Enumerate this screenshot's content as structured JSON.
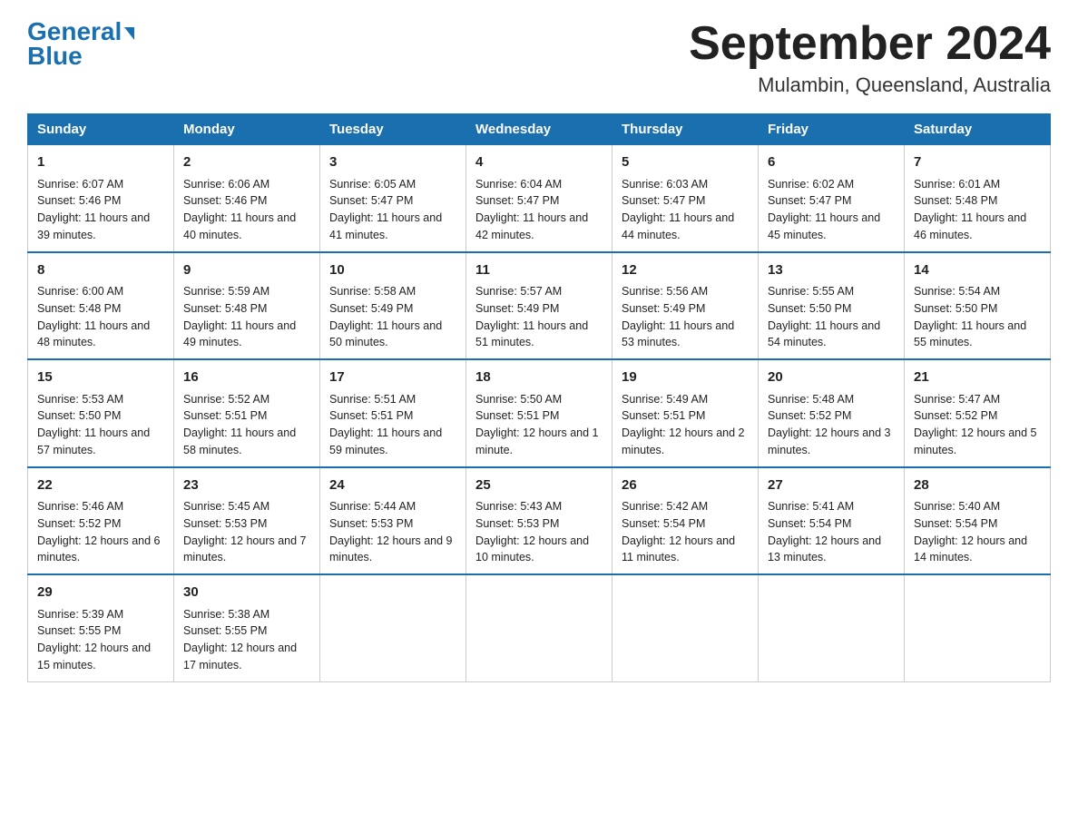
{
  "logo": {
    "general": "General",
    "blue": "Blue",
    "arrowColor": "#1a6fae"
  },
  "title": "September 2024",
  "location": "Mulambin, Queensland, Australia",
  "days_header": [
    "Sunday",
    "Monday",
    "Tuesday",
    "Wednesday",
    "Thursday",
    "Friday",
    "Saturday"
  ],
  "weeks": [
    [
      {
        "day": "1",
        "sunrise": "6:07 AM",
        "sunset": "5:46 PM",
        "daylight": "11 hours and 39 minutes."
      },
      {
        "day": "2",
        "sunrise": "6:06 AM",
        "sunset": "5:46 PM",
        "daylight": "11 hours and 40 minutes."
      },
      {
        "day": "3",
        "sunrise": "6:05 AM",
        "sunset": "5:47 PM",
        "daylight": "11 hours and 41 minutes."
      },
      {
        "day": "4",
        "sunrise": "6:04 AM",
        "sunset": "5:47 PM",
        "daylight": "11 hours and 42 minutes."
      },
      {
        "day": "5",
        "sunrise": "6:03 AM",
        "sunset": "5:47 PM",
        "daylight": "11 hours and 44 minutes."
      },
      {
        "day": "6",
        "sunrise": "6:02 AM",
        "sunset": "5:47 PM",
        "daylight": "11 hours and 45 minutes."
      },
      {
        "day": "7",
        "sunrise": "6:01 AM",
        "sunset": "5:48 PM",
        "daylight": "11 hours and 46 minutes."
      }
    ],
    [
      {
        "day": "8",
        "sunrise": "6:00 AM",
        "sunset": "5:48 PM",
        "daylight": "11 hours and 48 minutes."
      },
      {
        "day": "9",
        "sunrise": "5:59 AM",
        "sunset": "5:48 PM",
        "daylight": "11 hours and 49 minutes."
      },
      {
        "day": "10",
        "sunrise": "5:58 AM",
        "sunset": "5:49 PM",
        "daylight": "11 hours and 50 minutes."
      },
      {
        "day": "11",
        "sunrise": "5:57 AM",
        "sunset": "5:49 PM",
        "daylight": "11 hours and 51 minutes."
      },
      {
        "day": "12",
        "sunrise": "5:56 AM",
        "sunset": "5:49 PM",
        "daylight": "11 hours and 53 minutes."
      },
      {
        "day": "13",
        "sunrise": "5:55 AM",
        "sunset": "5:50 PM",
        "daylight": "11 hours and 54 minutes."
      },
      {
        "day": "14",
        "sunrise": "5:54 AM",
        "sunset": "5:50 PM",
        "daylight": "11 hours and 55 minutes."
      }
    ],
    [
      {
        "day": "15",
        "sunrise": "5:53 AM",
        "sunset": "5:50 PM",
        "daylight": "11 hours and 57 minutes."
      },
      {
        "day": "16",
        "sunrise": "5:52 AM",
        "sunset": "5:51 PM",
        "daylight": "11 hours and 58 minutes."
      },
      {
        "day": "17",
        "sunrise": "5:51 AM",
        "sunset": "5:51 PM",
        "daylight": "11 hours and 59 minutes."
      },
      {
        "day": "18",
        "sunrise": "5:50 AM",
        "sunset": "5:51 PM",
        "daylight": "12 hours and 1 minute."
      },
      {
        "day": "19",
        "sunrise": "5:49 AM",
        "sunset": "5:51 PM",
        "daylight": "12 hours and 2 minutes."
      },
      {
        "day": "20",
        "sunrise": "5:48 AM",
        "sunset": "5:52 PM",
        "daylight": "12 hours and 3 minutes."
      },
      {
        "day": "21",
        "sunrise": "5:47 AM",
        "sunset": "5:52 PM",
        "daylight": "12 hours and 5 minutes."
      }
    ],
    [
      {
        "day": "22",
        "sunrise": "5:46 AM",
        "sunset": "5:52 PM",
        "daylight": "12 hours and 6 minutes."
      },
      {
        "day": "23",
        "sunrise": "5:45 AM",
        "sunset": "5:53 PM",
        "daylight": "12 hours and 7 minutes."
      },
      {
        "day": "24",
        "sunrise": "5:44 AM",
        "sunset": "5:53 PM",
        "daylight": "12 hours and 9 minutes."
      },
      {
        "day": "25",
        "sunrise": "5:43 AM",
        "sunset": "5:53 PM",
        "daylight": "12 hours and 10 minutes."
      },
      {
        "day": "26",
        "sunrise": "5:42 AM",
        "sunset": "5:54 PM",
        "daylight": "12 hours and 11 minutes."
      },
      {
        "day": "27",
        "sunrise": "5:41 AM",
        "sunset": "5:54 PM",
        "daylight": "12 hours and 13 minutes."
      },
      {
        "day": "28",
        "sunrise": "5:40 AM",
        "sunset": "5:54 PM",
        "daylight": "12 hours and 14 minutes."
      }
    ],
    [
      {
        "day": "29",
        "sunrise": "5:39 AM",
        "sunset": "5:55 PM",
        "daylight": "12 hours and 15 minutes."
      },
      {
        "day": "30",
        "sunrise": "5:38 AM",
        "sunset": "5:55 PM",
        "daylight": "12 hours and 17 minutes."
      },
      null,
      null,
      null,
      null,
      null
    ]
  ],
  "labels": {
    "sunrise": "Sunrise:",
    "sunset": "Sunset:",
    "daylight": "Daylight:"
  }
}
